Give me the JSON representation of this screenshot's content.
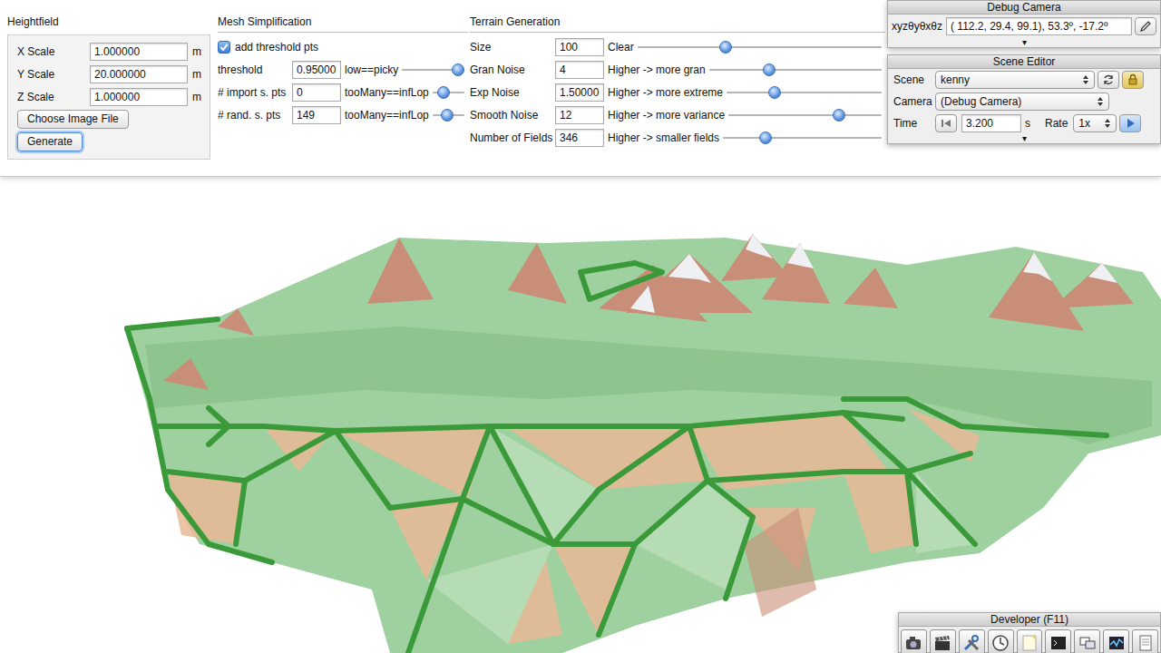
{
  "heightfield": {
    "title": "Heightfield",
    "rows": [
      {
        "label": "X Scale",
        "value": "1.000000",
        "unit": "m"
      },
      {
        "label": "Y Scale",
        "value": "20.000000",
        "unit": "m"
      },
      {
        "label": "Z Scale",
        "value": "1.000000",
        "unit": "m"
      }
    ],
    "buttons": [
      {
        "label": "Choose Image File",
        "focused": false
      },
      {
        "label": "Generate",
        "focused": true
      }
    ]
  },
  "mesh_simplification": {
    "title": "Mesh Simplification",
    "checkbox": {
      "label": "add threshold pts",
      "checked": true
    },
    "rows": [
      {
        "label": "threshold",
        "value": "0.95000",
        "hint": "low==picky",
        "level": 0.9
      },
      {
        "label": "# import s. pts",
        "value": "0",
        "hint": "tooMany==infLop",
        "level": 0.35
      },
      {
        "label": "# rand. s. pts",
        "value": "149",
        "hint": "tooMany==infLop",
        "level": 0.45
      }
    ]
  },
  "terrain_generation": {
    "title": "Terrain Generation",
    "rows": [
      {
        "label": "Size",
        "value": "100",
        "hint": "Clear",
        "level": 0.36
      },
      {
        "label": "Gran Noise",
        "value": "4",
        "hint": "Higher -> more gran",
        "level": 0.35
      },
      {
        "label": "Exp Noise",
        "value": "1.50000",
        "hint": "Higher -> more extreme",
        "level": 0.31
      },
      {
        "label": "Smooth Noise",
        "value": "12",
        "hint": "Higher -> more variance",
        "level": 0.72
      },
      {
        "label": "Number of Fields",
        "value": "346",
        "hint": "Higher -> smaller fields",
        "level": 0.27
      }
    ]
  },
  "debug_camera": {
    "title": "Debug Camera",
    "label": "xyzθyθxθz",
    "value": "( 112.2,  29.4,  99.1),  53.3º, -17.2º",
    "expander": "▾"
  },
  "scene_editor": {
    "title": "Scene Editor",
    "scene_label": "Scene",
    "scene": "kenny",
    "camera_label": "Camera",
    "camera": "(Debug Camera)",
    "time_label": "Time",
    "time": "3.200",
    "time_unit": "s",
    "rate_label": "Rate",
    "rate": "1x",
    "expander": "▾"
  },
  "developer": {
    "title": "Developer (F11)"
  }
}
